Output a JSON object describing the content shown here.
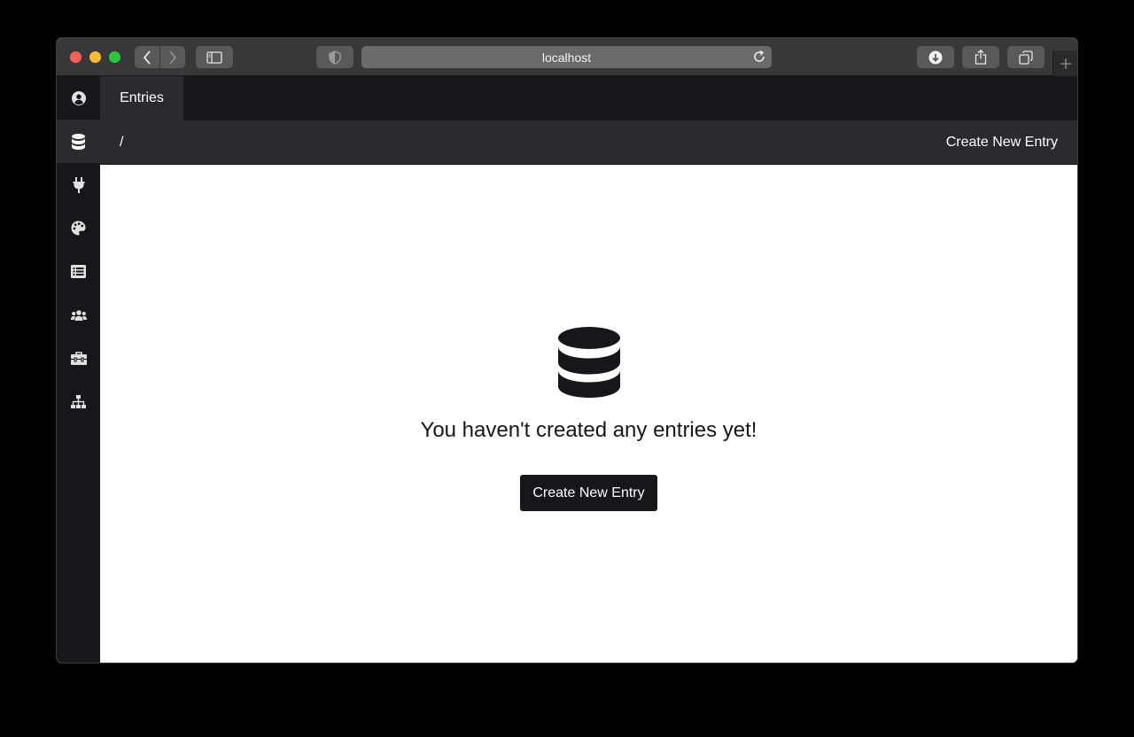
{
  "browser": {
    "url": "localhost",
    "icons": [
      "back-icon",
      "forward-icon",
      "sidebar-icon",
      "shield-icon",
      "reload-icon",
      "download-icon",
      "share-icon",
      "tabs-icon",
      "plus-icon"
    ]
  },
  "sidebar": {
    "items": [
      {
        "icon": "user-icon"
      },
      {
        "icon": "database-icon",
        "active": true
      },
      {
        "icon": "plug-icon"
      },
      {
        "icon": "palette-icon"
      },
      {
        "icon": "list-icon"
      },
      {
        "icon": "users-icon"
      },
      {
        "icon": "toolbox-icon"
      },
      {
        "icon": "sitemap-icon"
      }
    ]
  },
  "topbar": {
    "tab_label": "Entries"
  },
  "subbar": {
    "breadcrumb": "/",
    "create_label": "Create New Entry"
  },
  "empty_state": {
    "icon": "database-icon",
    "message": "You haven't created any entries yet!",
    "button_label": "Create New Entry"
  },
  "colors": {
    "sidebar_bg": "#16171b",
    "active_bg": "#2a2b31",
    "button_bg": "#16171b"
  }
}
